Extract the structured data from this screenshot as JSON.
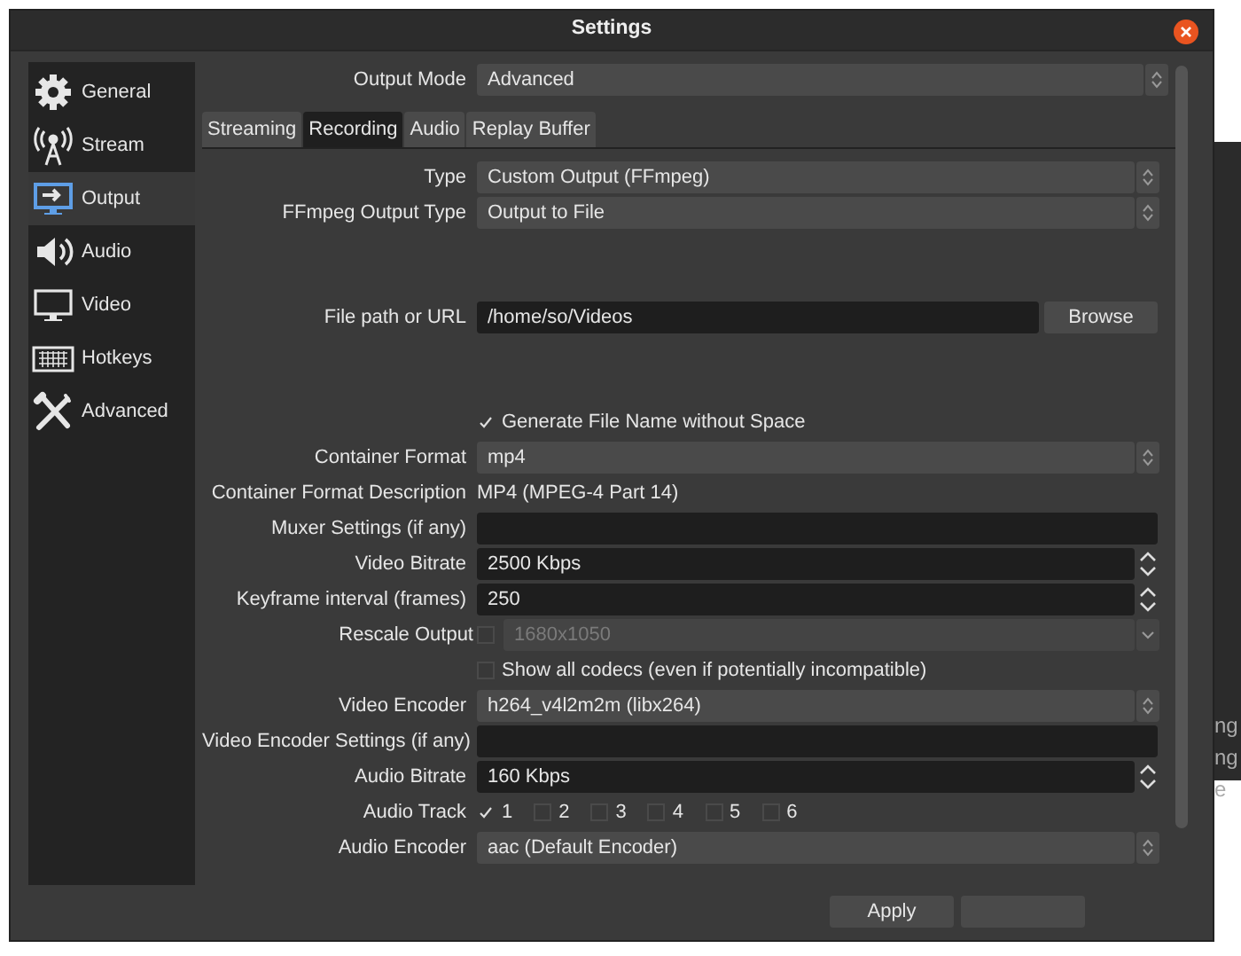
{
  "window": {
    "title": "Settings"
  },
  "sidebar": {
    "items": [
      {
        "label": "General",
        "selected": false
      },
      {
        "label": "Stream",
        "selected": false
      },
      {
        "label": "Output",
        "selected": true
      },
      {
        "label": "Audio",
        "selected": false
      },
      {
        "label": "Video",
        "selected": false
      },
      {
        "label": "Hotkeys",
        "selected": false
      },
      {
        "label": "Advanced",
        "selected": false
      }
    ]
  },
  "output_mode": {
    "label": "Output Mode",
    "value": "Advanced"
  },
  "tabs": [
    {
      "label": "Streaming",
      "selected": false
    },
    {
      "label": "Recording",
      "selected": true
    },
    {
      "label": "Audio",
      "selected": false
    },
    {
      "label": "Replay Buffer",
      "selected": false
    }
  ],
  "sections": [
    [
      {
        "kind": "select",
        "label": "Type",
        "value": "Custom Output (FFmpeg)"
      },
      {
        "kind": "select",
        "label": "FFmpeg Output Type",
        "value": "Output to File"
      }
    ],
    [
      {
        "kind": "file",
        "label": "File path or URL",
        "value": "/home/so/Videos",
        "button": "Browse"
      }
    ],
    [
      {
        "kind": "check",
        "text": "Generate File Name without Space",
        "checked": true
      },
      {
        "kind": "select",
        "label": "Container Format",
        "value": "mp4"
      },
      {
        "kind": "text",
        "label": "Container Format Description",
        "value": "MP4 (MPEG-4 Part 14)"
      },
      {
        "kind": "input",
        "label": "Muxer Settings (if any)"
      },
      {
        "kind": "spin",
        "label": "Video Bitrate",
        "value": "2500 Kbps"
      },
      {
        "kind": "spin",
        "label": "Keyframe interval (frames)",
        "value": "250"
      },
      {
        "kind": "check_select",
        "label": "Rescale Output",
        "checked": false,
        "value": "1680x1050",
        "disabled": true
      },
      {
        "kind": "check",
        "text": "Show all codecs (even if potentially incompatible)",
        "checked": false
      },
      {
        "kind": "select",
        "label": "Video Encoder",
        "value": "h264_v4l2m2m (libx264)"
      },
      {
        "kind": "input",
        "label": "Video Encoder Settings (if any)"
      },
      {
        "kind": "spin",
        "label": "Audio Bitrate",
        "value": "160 Kbps"
      },
      {
        "kind": "tracks",
        "label": "Audio Track",
        "tracks": [
          {
            "label": "1",
            "checked": true
          },
          {
            "label": "2",
            "checked": false
          },
          {
            "label": "3",
            "checked": false
          },
          {
            "label": "4",
            "checked": false
          },
          {
            "label": "5",
            "checked": false
          },
          {
            "label": "6",
            "checked": false
          }
        ]
      },
      {
        "kind": "select",
        "label": "Audio Encoder",
        "value": "aac (Default Encoder)"
      }
    ]
  ],
  "buttons": [
    {
      "label": "Apply"
    }
  ],
  "background_window": {
    "texts": [
      "ng",
      "ng",
      "e"
    ]
  }
}
